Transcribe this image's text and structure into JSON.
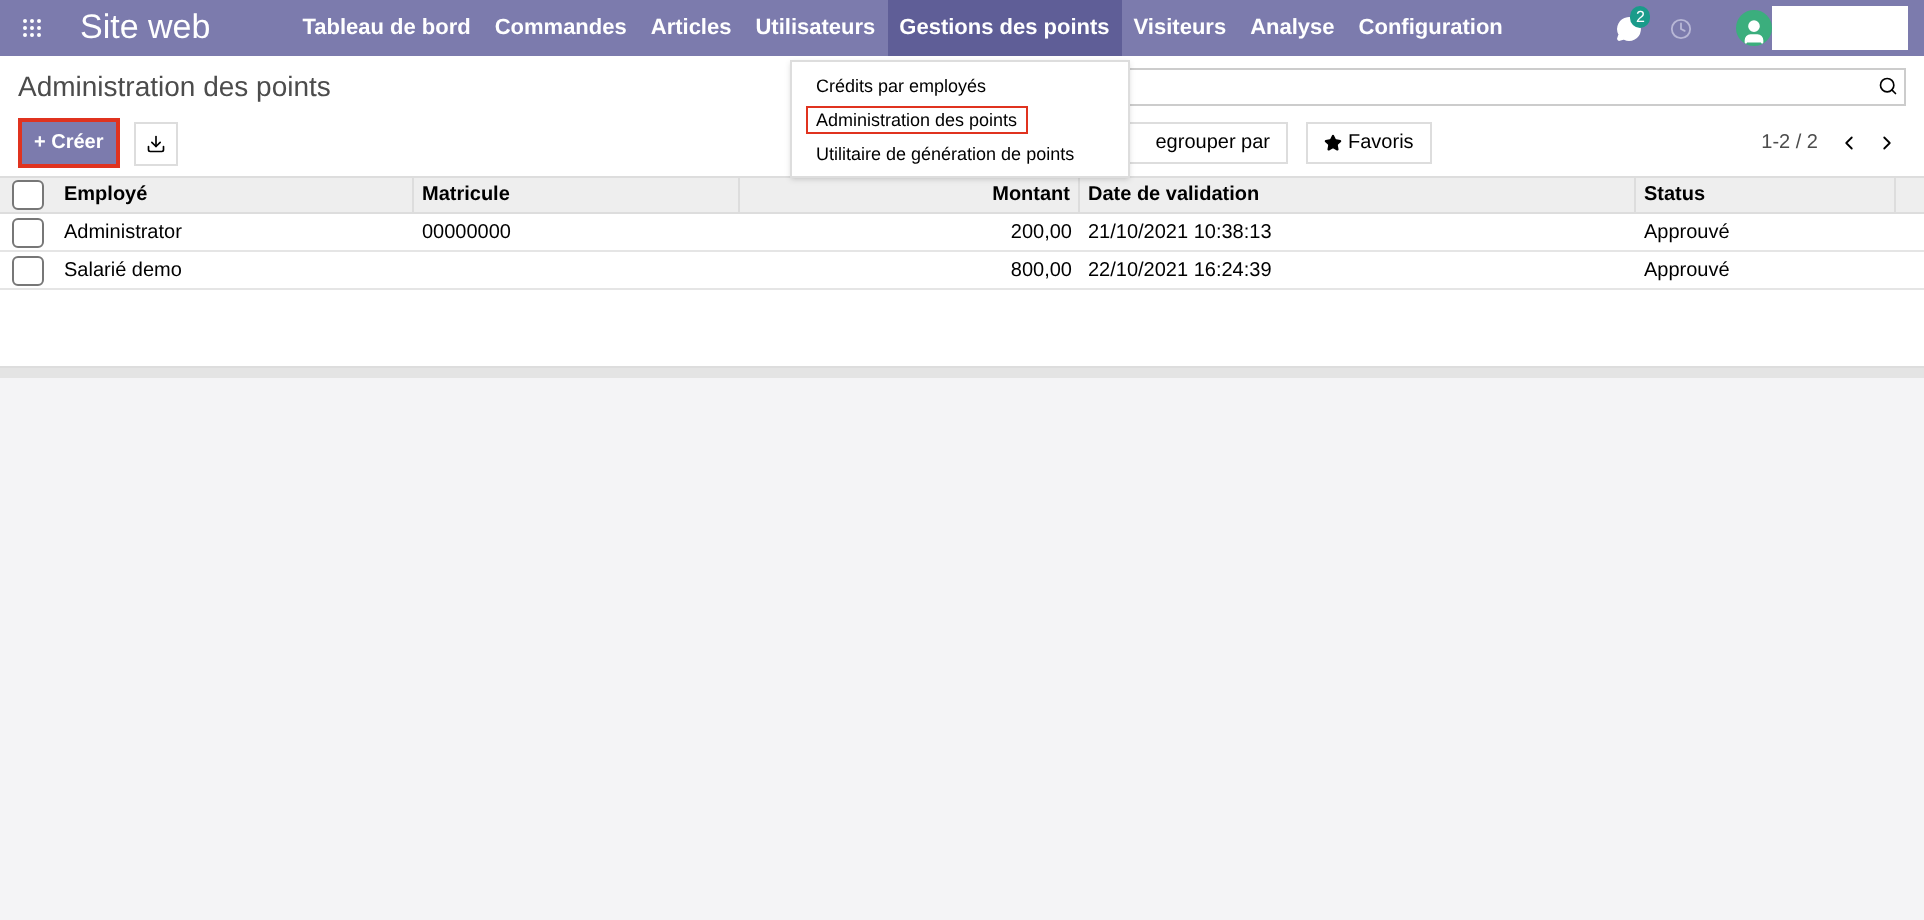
{
  "navbar": {
    "app_title": "Site web",
    "menu": [
      {
        "label": "Tableau de bord",
        "selected": false
      },
      {
        "label": "Commandes",
        "selected": false
      },
      {
        "label": "Articles",
        "selected": false
      },
      {
        "label": "Utilisateurs",
        "selected": false
      },
      {
        "label": "Gestions des points",
        "selected": true
      },
      {
        "label": "Visiteurs",
        "selected": false
      },
      {
        "label": "Analyse",
        "selected": false
      },
      {
        "label": "Configuration",
        "selected": false
      }
    ],
    "messages_badge": "2"
  },
  "dropdown": {
    "items": [
      {
        "label": "Crédits par employés",
        "highlighted": false
      },
      {
        "label": "Administration des points",
        "highlighted": true
      },
      {
        "label": "Utilitaire de génération de points",
        "highlighted": false
      }
    ]
  },
  "control_panel": {
    "title": "Administration des points",
    "create_button": {
      "label": "+ Créer",
      "highlighted": true
    },
    "group_button": "egrouper par",
    "favorites_button": "Favoris",
    "pager": "1-2 / 2"
  },
  "table": {
    "all_selected": false,
    "columns": [
      {
        "label": "Employé"
      },
      {
        "label": "Matricule"
      },
      {
        "label": "Montant"
      },
      {
        "label": "Date de validation"
      },
      {
        "label": "Status"
      }
    ],
    "rows": [
      {
        "cells": [
          "Administrator",
          "00000000",
          "200,00",
          "21/10/2021 10:38:13",
          "Approuvé"
        ],
        "selected": false
      },
      {
        "cells": [
          "Salarié demo",
          "",
          "800,00",
          "22/10/2021 16:24:39",
          "Approuvé"
        ],
        "selected": false
      }
    ]
  }
}
